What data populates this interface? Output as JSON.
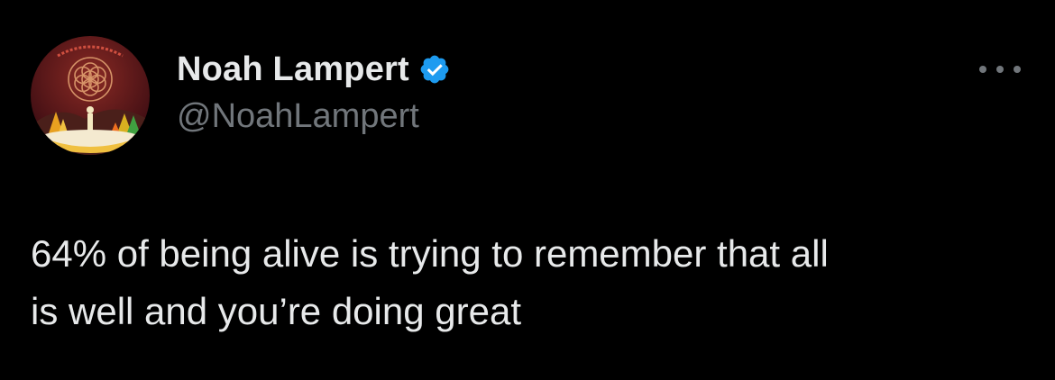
{
  "tweet": {
    "author": {
      "display_name": "Noah Lampert",
      "handle": "@NoahLampert",
      "verified": true,
      "avatar_icon": "synchronicity-mandala-avatar"
    },
    "more_icon": "more-dots-icon",
    "text": "64% of being alive is trying to remember that all\nis well and you’re doing great"
  },
  "colors": {
    "background": "#000000",
    "text_primary": "#e7e9ea",
    "text_secondary": "#71767b",
    "verified_blue": "#1d9bf0"
  }
}
